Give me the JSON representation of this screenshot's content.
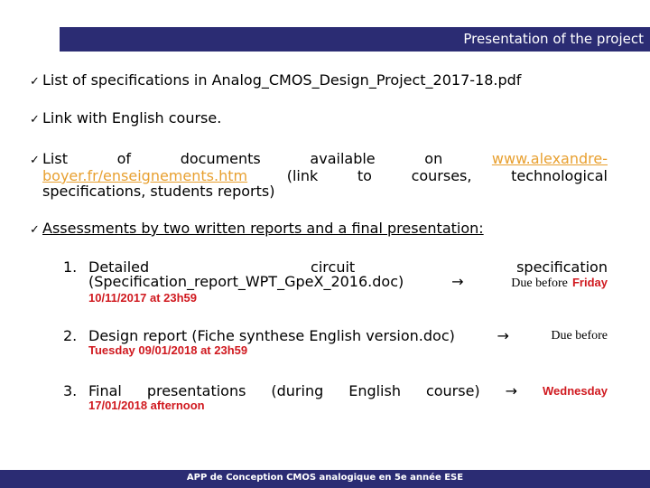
{
  "header": {
    "title": "Presentation of the project"
  },
  "colors": {
    "bar": "#2b2c73",
    "link": "#e8a030",
    "deadline": "#d0191f"
  },
  "bullets": [
    {
      "icon": "checkmark",
      "glyph": "✓",
      "text": "List of specifications in Analog_CMOS_Design_Project_2017-18.pdf"
    },
    {
      "icon": "checkmark",
      "glyph": "✓",
      "text": "Link with English course."
    },
    {
      "icon": "checkmark",
      "glyph": "✓",
      "line1_words": [
        "List",
        "of",
        "documents",
        "available",
        "on"
      ],
      "link_part1": "www.alexandre-",
      "link_part2": "boyer.fr/enseignements.htm",
      "line2_words": [
        "(link",
        "to",
        "courses,",
        "technological"
      ],
      "line3": "specifications, students reports)"
    },
    {
      "icon": "checkmark",
      "glyph": "✓",
      "text": "Assessments by two written reports and a final presentation:"
    }
  ],
  "deliverables": [
    {
      "number": "1.",
      "line1_words": [
        "Detailed",
        "circuit",
        "specification"
      ],
      "line2": "(Specification_report_WPT_GpeX_2016.doc)",
      "arrow": "→",
      "due_label": "Due before",
      "deadline_part1": "Friday",
      "deadline_part2": "10/11/2017 at 23h59"
    },
    {
      "number": "2.",
      "line1": "Design report (Fiche synthese English version.doc)",
      "arrow": "→",
      "due_label": "Due before",
      "deadline_part2": "Tuesday 09/01/2018 at 23h59"
    },
    {
      "number": "3.",
      "line1_words": [
        "Final",
        "presentations",
        "(during",
        "English",
        "course)"
      ],
      "arrow": "→",
      "deadline_part1": "Wednesday",
      "deadline_part2": "17/01/2018 afternoon"
    }
  ],
  "footer": {
    "text": "APP de Conception CMOS analogique en 5e année ESE"
  }
}
